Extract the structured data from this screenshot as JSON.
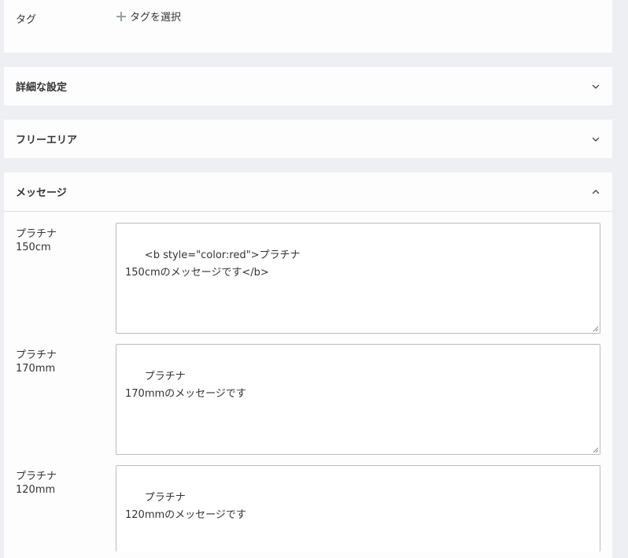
{
  "tag": {
    "label": "タグ",
    "select_label": "タグを選択"
  },
  "sections": {
    "advanced": {
      "title": "詳細な設定",
      "icon": "chevron-down-icon"
    },
    "free_area": {
      "title": "フリーエリア",
      "icon": "chevron-down-icon"
    },
    "message": {
      "title": "メッセージ",
      "icon": "chevron-up-icon"
    }
  },
  "messages": [
    {
      "label_line1": "プラチナ",
      "label_line2": "150cm",
      "value": "<b style=\"color:red\">プラチナ\n150cmのメッセージです</b>"
    },
    {
      "label_line1": "プラチナ",
      "label_line2": "170mm",
      "value": "プラチナ\n170mmのメッセージです"
    },
    {
      "label_line1": "プラチナ",
      "label_line2": "120mm",
      "value": "プラチナ\n120mmのメッセージです"
    }
  ]
}
